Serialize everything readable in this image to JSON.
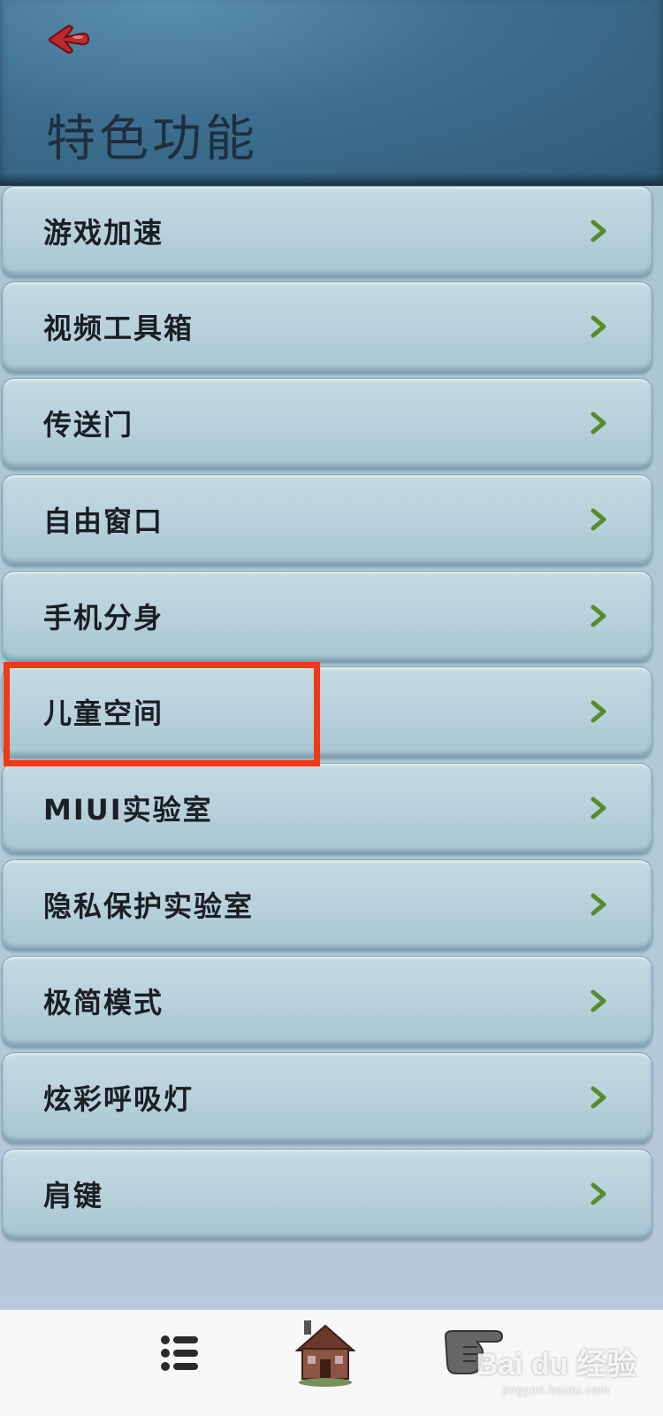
{
  "header": {
    "title": "特色功能",
    "back_icon": "back-arrow-icon"
  },
  "items": [
    {
      "label": "游戏加速"
    },
    {
      "label": "视频工具箱"
    },
    {
      "label": "传送门"
    },
    {
      "label": "自由窗口"
    },
    {
      "label": "手机分身"
    },
    {
      "label": "儿童空间"
    },
    {
      "label": "MIUI实验室"
    },
    {
      "label": "隐私保护实验室"
    },
    {
      "label": "极简模式"
    },
    {
      "label": "炫彩呼吸灯"
    },
    {
      "label": "肩键"
    }
  ],
  "highlighted_item": "儿童空间",
  "colors": {
    "highlight": "#f03a17",
    "chevron": "#5a8a2a",
    "back_icon": "#c0282f"
  },
  "bottom_nav": [
    {
      "icon": "menu-list-icon"
    },
    {
      "icon": "home-house-icon"
    },
    {
      "icon": "pointing-hand-icon"
    }
  ],
  "watermark": {
    "main": "Bai du 经验",
    "sub": "jingyan.baidu.com"
  }
}
